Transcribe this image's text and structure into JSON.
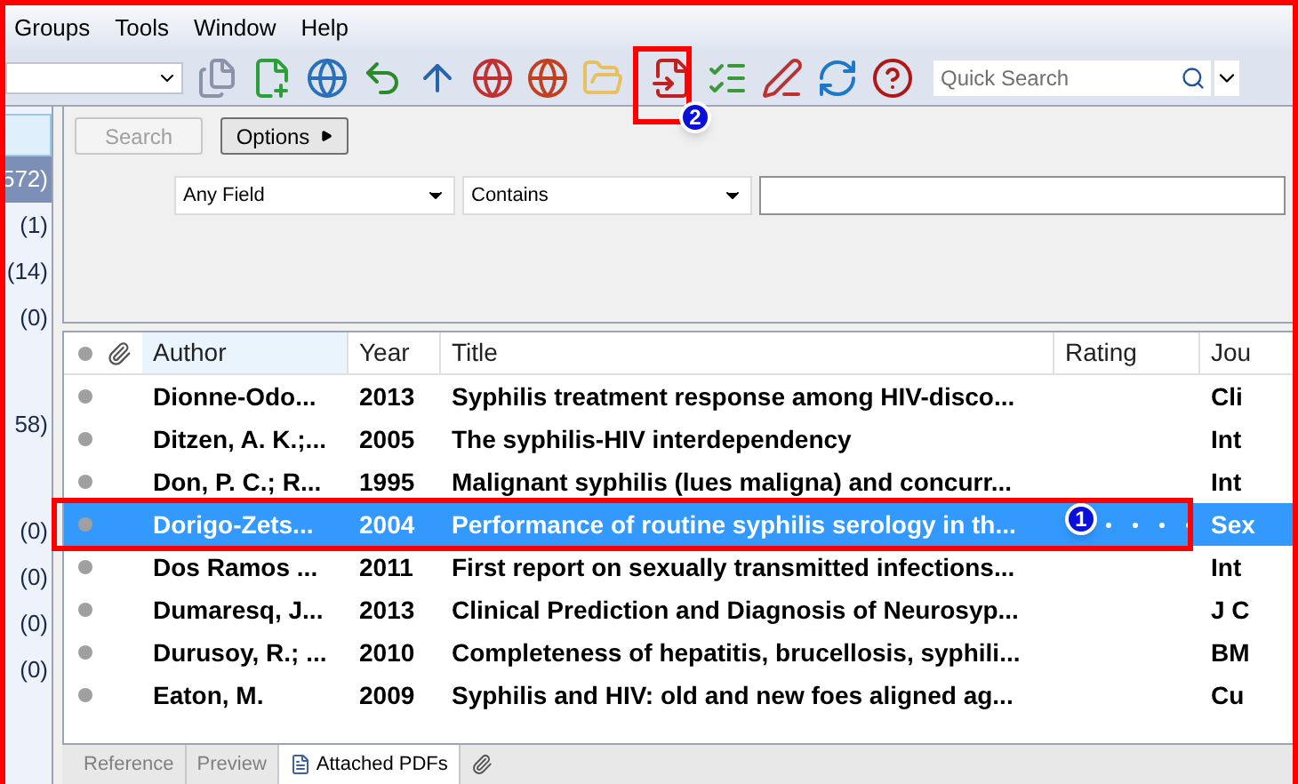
{
  "menu": [
    "Groups",
    "Tools",
    "Window",
    "Help"
  ],
  "toolbar": {
    "quick_search": {
      "placeholder": "Quick Search"
    }
  },
  "groups": [
    {
      "count": "572)",
      "selected": true
    },
    {
      "count": "(1)",
      "selected": false
    },
    {
      "count": "(14)",
      "selected": false
    },
    {
      "count": "(0)",
      "selected": false
    },
    {
      "count": "58)",
      "selected": false
    },
    {
      "count": "(0)",
      "selected": false
    },
    {
      "count": "(0)",
      "selected": false
    },
    {
      "count": "(0)",
      "selected": false
    },
    {
      "count": "(0)",
      "selected": false
    }
  ],
  "search_panel": {
    "search_button": {
      "label": "Search",
      "disabled": true
    },
    "options_button": "Options",
    "field": "Any Field",
    "condition": "Contains"
  },
  "table": {
    "columns": [
      "Author",
      "Year",
      "Title",
      "Rating",
      "Jou"
    ],
    "rows": [
      {
        "author": "Dionne-Odo...",
        "year": "2013",
        "title": "Syphilis treatment response among HIV-disco...",
        "journal": "Cli",
        "selected": false
      },
      {
        "author": "Ditzen, A. K.;...",
        "year": "2005",
        "title": "The syphilis-HIV interdependency",
        "journal": "Int",
        "selected": false
      },
      {
        "author": "Don, P. C.; R...",
        "year": "1995",
        "title": "Malignant syphilis (lues maligna) and concurr...",
        "journal": "Int",
        "selected": false
      },
      {
        "author": "Dorigo-Zets...",
        "year": "2004",
        "title": "Performance of routine syphilis serology in th...",
        "journal": "Sex",
        "selected": true
      },
      {
        "author": "Dos Ramos ...",
        "year": "2011",
        "title": "First report on sexually transmitted infections...",
        "journal": "Int",
        "selected": false
      },
      {
        "author": "Dumaresq, J...",
        "year": "2013",
        "title": "Clinical Prediction and Diagnosis of Neurosyp...",
        "journal": "J C",
        "selected": false
      },
      {
        "author": "Durusoy, R.; ...",
        "year": "2010",
        "title": "Completeness of hepatitis, brucellosis, syphili...",
        "journal": "BM",
        "selected": false
      },
      {
        "author": "Eaton, M.",
        "year": "2009",
        "title": "Syphilis and HIV: old and new foes aligned ag...",
        "journal": "Cu",
        "selected": false
      }
    ]
  },
  "bottom_tabs": [
    {
      "label": "Reference",
      "selected": false
    },
    {
      "label": "Preview",
      "selected": false
    },
    {
      "label": "Attached PDFs",
      "selected": true
    }
  ],
  "annotations": [
    "1",
    "2"
  ]
}
